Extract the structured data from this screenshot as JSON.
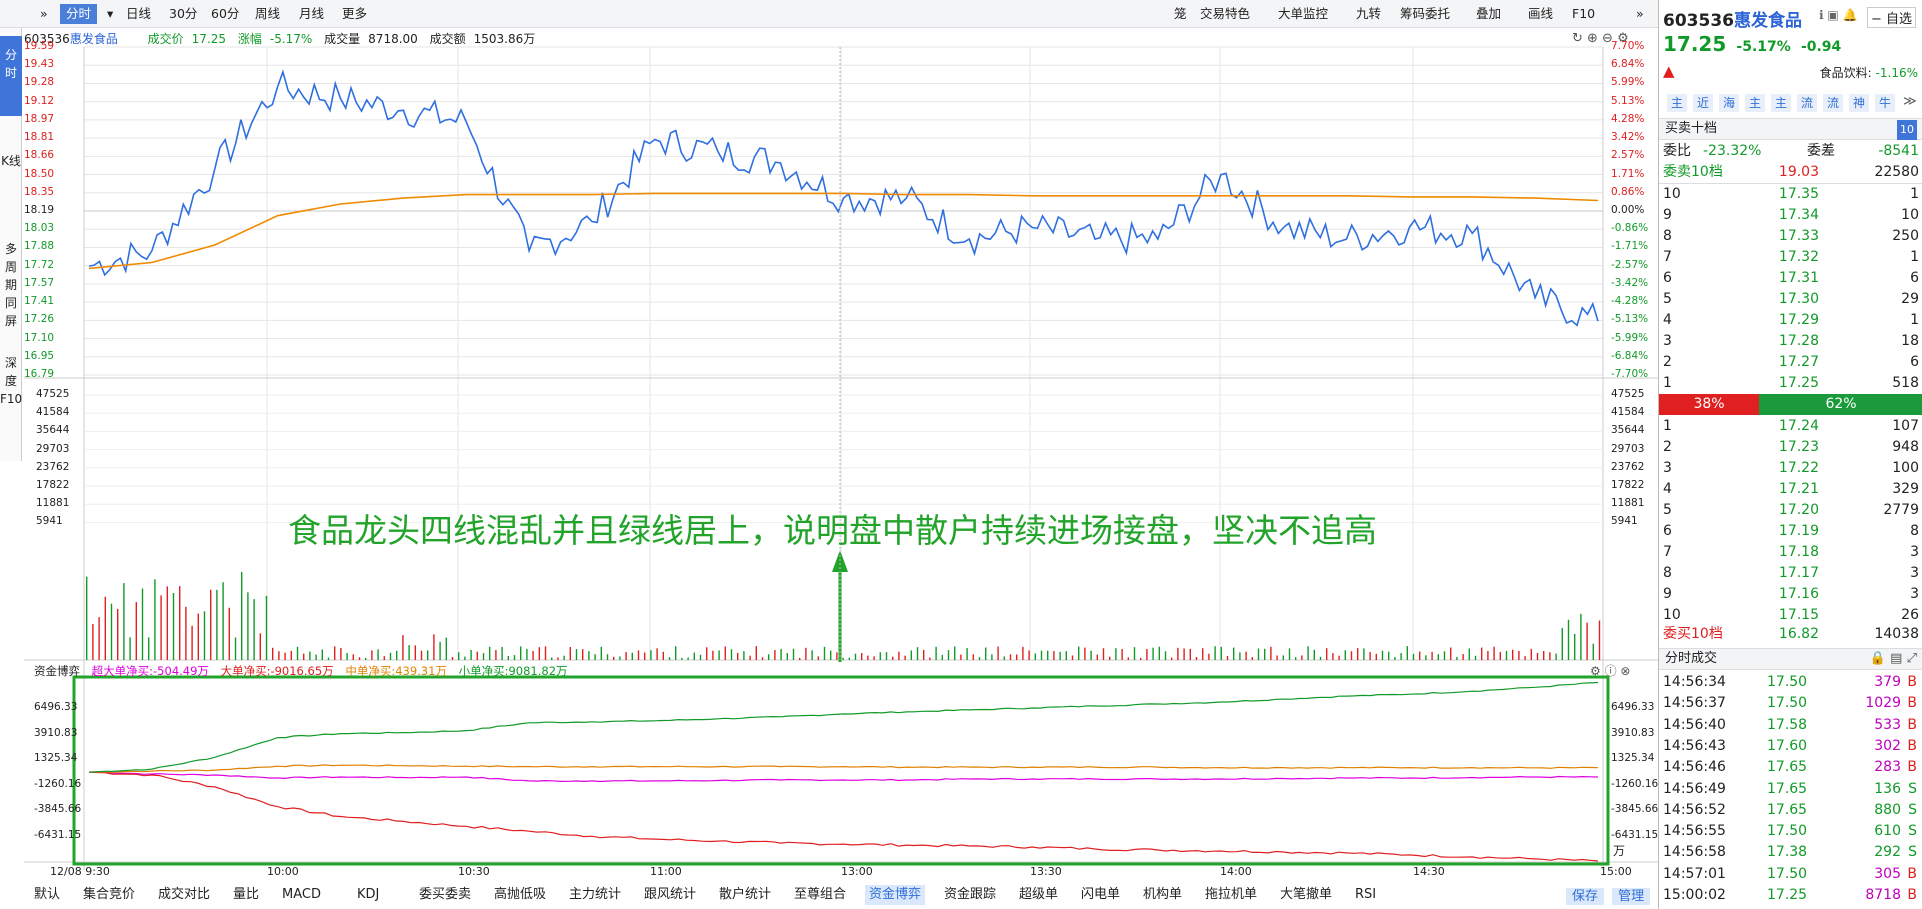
{
  "toolbar": {
    "left": [
      "分时",
      "日线",
      "30分",
      "60分",
      "周线",
      "月线",
      "更多"
    ],
    "right": [
      "笼",
      "交易特色",
      "大单监控",
      "九转",
      "筹码委托",
      "叠加",
      "画线",
      "F10"
    ]
  },
  "left_tabs": [
    "分时",
    "K线",
    "多周期同屏",
    "深度F10"
  ],
  "info": {
    "code": "603536",
    "name": "惠发食品",
    "price_label": "成交价",
    "price": "17.25",
    "change_label": "涨幅",
    "change": "-5.17%",
    "volume_label": "成交量",
    "volume": "8718.00",
    "amount_label": "成交额",
    "amount": "1503.86万"
  },
  "price_axis": {
    "left": [
      "19.59",
      "19.43",
      "19.28",
      "19.12",
      "18.97",
      "18.81",
      "18.66",
      "18.50",
      "18.35",
      "18.19",
      "18.03",
      "17.88",
      "17.72",
      "17.57",
      "17.41",
      "17.26",
      "17.10",
      "16.95",
      "16.79"
    ],
    "right": [
      "7.70%",
      "6.84%",
      "5.99%",
      "5.13%",
      "4.28%",
      "3.42%",
      "2.57%",
      "1.71%",
      "0.86%",
      "0.00%",
      "-0.86%",
      "-1.71%",
      "-2.57%",
      "-3.42%",
      "-4.28%",
      "-5.13%",
      "-5.99%",
      "-6.84%",
      "-7.70%"
    ]
  },
  "volume_axis": [
    "47525",
    "41584",
    "35644",
    "29703",
    "23762",
    "17822",
    "11881",
    "5941"
  ],
  "fund_legend": {
    "title": "资金博弈",
    "super": "超大单净买:-504.49万",
    "large": "大单净买:-9016.65万",
    "mid": "中单净买:439.31万",
    "small": "小单净买:9081.82万"
  },
  "fund_axis": [
    "6496.33",
    "3910.83",
    "1325.34",
    "-1260.16",
    "-3845.66",
    "-6431.15"
  ],
  "fund_unit": "万",
  "time_axis": [
    "12/08 9:30",
    "10:00",
    "10:30",
    "11:00",
    "13:00",
    "13:30",
    "14:00",
    "14:30",
    "15:00"
  ],
  "annotation": "食品龙头四线混乱并且绿线居上，说明盘中散户持续进场接盘，坚决不追高",
  "bottom_tabs": [
    "默认",
    "集合竞价",
    "成交对比",
    "量比",
    "MACD",
    "KDJ",
    "委买委卖",
    "高抛低吸",
    "主力统计",
    "跟风统计",
    "散户统计",
    "至尊组合",
    "资金博弈",
    "资金跟踪",
    "超级单",
    "闪电单",
    "机构单",
    "拖拉机单",
    "大笔撤单",
    "RSI"
  ],
  "bottom_right": [
    "保存",
    "管理"
  ],
  "right": {
    "code": "603536",
    "name": "惠发食品",
    "fav": "自选",
    "price": "17.25",
    "pct": "-5.17%",
    "chg": "-0.94",
    "sector": "食品饮料:",
    "sector_pct": "-1.16%",
    "icons": [
      "主",
      "近",
      "海",
      "主",
      "主",
      "流",
      "流",
      "神",
      "牛"
    ],
    "book_title": "买卖十档",
    "book_badge": "10",
    "wei_bi_label": "委比",
    "wei_bi": "-23.32%",
    "wei_cha_label": "委差",
    "wei_cha": "-8541",
    "sell_head": {
      "label": "委卖10档",
      "price": "19.03",
      "vol": "22580"
    },
    "asks": [
      [
        "10",
        "17.35",
        "1"
      ],
      [
        "9",
        "17.34",
        "10"
      ],
      [
        "8",
        "17.33",
        "250"
      ],
      [
        "7",
        "17.32",
        "1"
      ],
      [
        "6",
        "17.31",
        "6"
      ],
      [
        "5",
        "17.30",
        "29"
      ],
      [
        "4",
        "17.29",
        "1"
      ],
      [
        "3",
        "17.28",
        "18"
      ],
      [
        "2",
        "17.27",
        "6"
      ],
      [
        "1",
        "17.25",
        "518"
      ]
    ],
    "ratio_sell": "38%",
    "ratio_buy": "62%",
    "bids": [
      [
        "1",
        "17.24",
        "107"
      ],
      [
        "2",
        "17.23",
        "948"
      ],
      [
        "3",
        "17.22",
        "100"
      ],
      [
        "4",
        "17.21",
        "329"
      ],
      [
        "5",
        "17.20",
        "2779"
      ],
      [
        "6",
        "17.19",
        "8"
      ],
      [
        "7",
        "17.18",
        "3"
      ],
      [
        "8",
        "17.17",
        "3"
      ],
      [
        "9",
        "17.16",
        "3"
      ],
      [
        "10",
        "17.15",
        "26"
      ]
    ],
    "buy_head": {
      "label": "委买10档",
      "price": "16.82",
      "vol": "14038"
    },
    "trades_title": "分时成交",
    "trades": [
      [
        "14:56:34",
        "17.50",
        "379",
        "B"
      ],
      [
        "14:56:37",
        "17.50",
        "1029",
        "B"
      ],
      [
        "14:56:40",
        "17.58",
        "533",
        "B"
      ],
      [
        "14:56:43",
        "17.60",
        "302",
        "B"
      ],
      [
        "14:56:46",
        "17.65",
        "283",
        "B"
      ],
      [
        "14:56:49",
        "17.65",
        "136",
        "S"
      ],
      [
        "14:56:52",
        "17.65",
        "880",
        "S"
      ],
      [
        "14:56:55",
        "17.50",
        "610",
        "S"
      ],
      [
        "14:56:58",
        "17.38",
        "292",
        "S"
      ],
      [
        "14:57:01",
        "17.50",
        "305",
        "B"
      ],
      [
        "15:00:02",
        "17.25",
        "8718",
        "B"
      ]
    ]
  },
  "chart_data": {
    "type": "line",
    "x": [
      "9:30",
      "9:40",
      "9:50",
      "10:00",
      "10:10",
      "10:20",
      "10:30",
      "10:40",
      "10:50",
      "11:00",
      "11:10",
      "11:20",
      "13:00",
      "13:10",
      "13:20",
      "13:30",
      "13:40",
      "13:50",
      "14:00",
      "14:10",
      "14:20",
      "14:30",
      "14:40",
      "14:50",
      "15:00"
    ],
    "series": [
      {
        "name": "price",
        "values": [
          17.72,
          17.85,
          18.55,
          19.25,
          19.15,
          19.05,
          18.95,
          17.85,
          18.1,
          18.8,
          18.7,
          18.6,
          18.3,
          18.3,
          17.95,
          18.05,
          17.95,
          17.95,
          18.5,
          18.05,
          17.95,
          18.05,
          18.0,
          17.45,
          17.25
        ]
      },
      {
        "name": "avg",
        "values": [
          17.7,
          17.75,
          17.9,
          18.15,
          18.25,
          18.3,
          18.33,
          18.33,
          18.33,
          18.34,
          18.34,
          18.34,
          18.34,
          18.33,
          18.33,
          18.32,
          18.32,
          18.32,
          18.32,
          18.32,
          18.32,
          18.31,
          18.31,
          18.3,
          18.28
        ]
      },
      {
        "name": "超大单净买",
        "values": [
          0,
          -200,
          -300,
          -600,
          -500,
          -550,
          -500,
          -900,
          -900,
          -900,
          -850,
          -800,
          -800,
          -800,
          -700,
          -700,
          -700,
          -700,
          -700,
          -650,
          -600,
          -600,
          -550,
          -500,
          -504
        ]
      },
      {
        "name": "大单净买",
        "values": [
          0,
          -300,
          -1500,
          -3500,
          -4500,
          -5000,
          -5500,
          -6000,
          -6500,
          -6800,
          -7000,
          -7200,
          -7300,
          -7400,
          -7500,
          -7600,
          -7800,
          -7900,
          -8000,
          -8100,
          -8200,
          -8400,
          -8600,
          -8800,
          -9016
        ]
      },
      {
        "name": "中单净买",
        "values": [
          0,
          100,
          200,
          600,
          700,
          650,
          600,
          550,
          550,
          550,
          550,
          550,
          550,
          500,
          500,
          500,
          500,
          500,
          450,
          450,
          450,
          450,
          450,
          430,
          439
        ]
      },
      {
        "name": "小单净买",
        "values": [
          0,
          300,
          1500,
          3500,
          3900,
          4000,
          4200,
          5000,
          5100,
          5200,
          5400,
          5600,
          5900,
          6100,
          6300,
          6500,
          6700,
          6900,
          7100,
          7400,
          7700,
          7900,
          8200,
          8600,
          9081
        ]
      }
    ],
    "ylim_price": [
      16.79,
      19.59
    ]
  }
}
